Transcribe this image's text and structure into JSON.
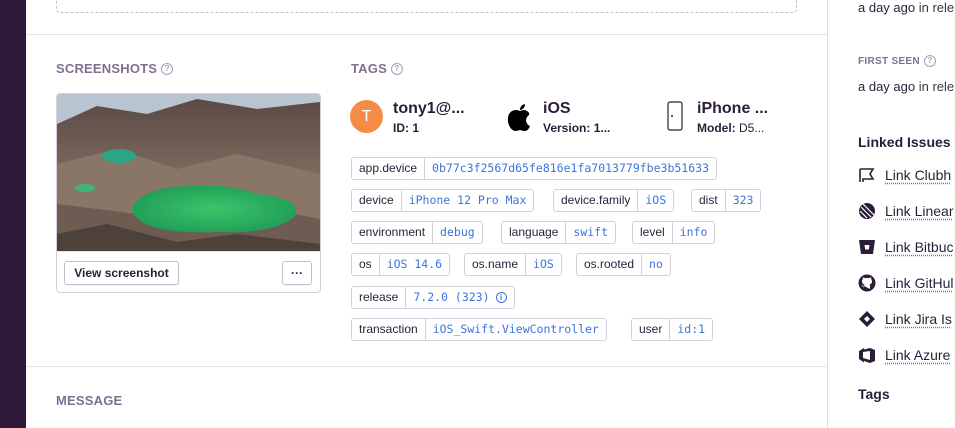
{
  "screenshots": {
    "title": "SCREENSHOTS",
    "view_button": "View screenshot",
    "menu_button": "···"
  },
  "tags_section": {
    "title": "TAGS",
    "context": [
      {
        "title": "tony1@...",
        "sub_label": "ID:",
        "sub_value": "1",
        "icon": "user-avatar"
      },
      {
        "title": "iOS",
        "sub_label": "Version:",
        "sub_value": "1...",
        "icon": "apple-icon"
      },
      {
        "title": "iPhone ...",
        "sub_label": "Model:",
        "sub_value": "D5...",
        "icon": "phone-icon"
      }
    ],
    "avatar_letter": "T",
    "avatar_color": "#f58c46",
    "tags": [
      {
        "key": "app.device",
        "value": "0b77c3f2567d65fe816e1fa7013779fbe3b51633"
      },
      {
        "key": "device",
        "value": "iPhone 12 Pro Max"
      },
      {
        "key": "device.family",
        "value": "iOS"
      },
      {
        "key": "dist",
        "value": "323"
      },
      {
        "key": "environment",
        "value": "debug"
      },
      {
        "key": "language",
        "value": "swift"
      },
      {
        "key": "level",
        "value": "info"
      },
      {
        "key": "os",
        "value": "iOS 14.6"
      },
      {
        "key": "os.name",
        "value": "iOS"
      },
      {
        "key": "os.rooted",
        "value": "no"
      },
      {
        "key": "release",
        "value": "7.2.0 (323)"
      },
      {
        "key": "transaction",
        "value": "iOS_Swift.ViewController"
      },
      {
        "key": "user",
        "value": "id:1"
      }
    ]
  },
  "message": {
    "title": "MESSAGE"
  },
  "sidebar": {
    "last_seen_value": "a day ago",
    "last_seen_suffix": "in rele",
    "first_seen_label": "FIRST SEEN",
    "first_seen_value": "a day ago",
    "first_seen_suffix": "in rele",
    "linked_issues_title": "Linked Issues",
    "links": [
      {
        "label": "Link Clubh",
        "icon": "clubhouse-icon"
      },
      {
        "label": "Link Linear",
        "icon": "linear-icon"
      },
      {
        "label": "Link Bitbuc",
        "icon": "bitbucket-icon"
      },
      {
        "label": "Link GitHul",
        "icon": "github-icon"
      },
      {
        "label": "Link Jira Is",
        "icon": "jira-icon"
      },
      {
        "label": "Link Azure",
        "icon": "azure-icon"
      }
    ],
    "tags_title": "Tags"
  },
  "colors": {
    "rail": "#2f1b39",
    "accent_blue": "#3d74db",
    "muted": "#80708f"
  }
}
